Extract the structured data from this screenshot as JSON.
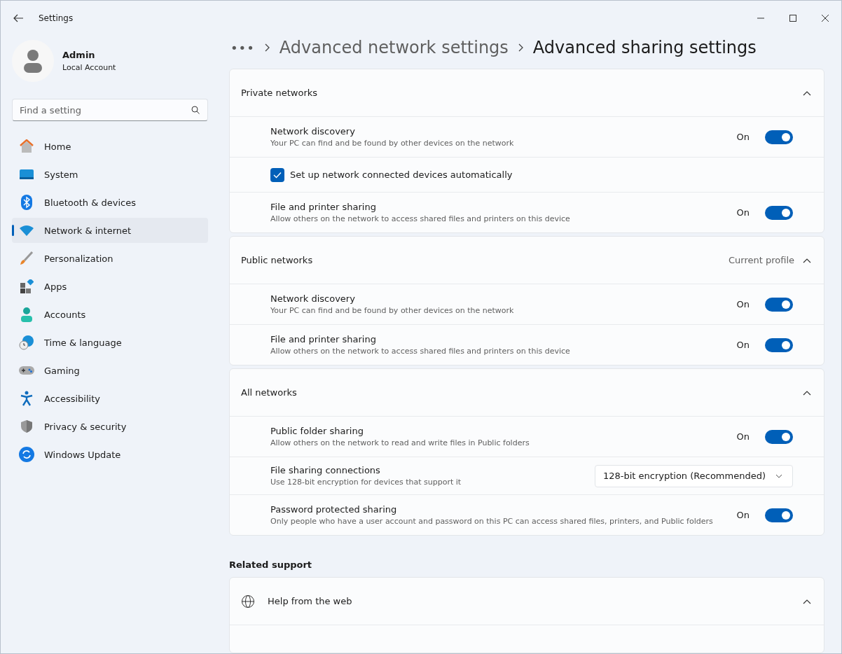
{
  "window": {
    "title": "Settings"
  },
  "user": {
    "name": "Admin",
    "account": "Local Account"
  },
  "search": {
    "placeholder": "Find a setting"
  },
  "sidebar": {
    "items": [
      {
        "label": "Home",
        "selected": false
      },
      {
        "label": "System",
        "selected": false
      },
      {
        "label": "Bluetooth & devices",
        "selected": false
      },
      {
        "label": "Network & internet",
        "selected": true
      },
      {
        "label": "Personalization",
        "selected": false
      },
      {
        "label": "Apps",
        "selected": false
      },
      {
        "label": "Accounts",
        "selected": false
      },
      {
        "label": "Time & language",
        "selected": false
      },
      {
        "label": "Gaming",
        "selected": false
      },
      {
        "label": "Accessibility",
        "selected": false
      },
      {
        "label": "Privacy & security",
        "selected": false
      },
      {
        "label": "Windows Update",
        "selected": false
      }
    ]
  },
  "breadcrumb": {
    "more": "•••",
    "items": [
      "Advanced network settings",
      "Advanced sharing settings"
    ]
  },
  "sections": [
    {
      "title": "Private networks",
      "expanded": true,
      "rows": [
        {
          "kind": "toggle",
          "title": "Network discovery",
          "description": "Your PC can find and be found by other devices on the network",
          "state_label": "On",
          "on": true
        },
        {
          "kind": "checkbox",
          "title": "Set up network connected devices automatically",
          "checked": true
        },
        {
          "kind": "toggle",
          "title": "File and printer sharing",
          "description": "Allow others on the network to access shared files and printers on this device",
          "state_label": "On",
          "on": true
        }
      ]
    },
    {
      "title": "Public networks",
      "note": "Current profile",
      "expanded": true,
      "rows": [
        {
          "kind": "toggle",
          "title": "Network discovery",
          "description": "Your PC can find and be found by other devices on the network",
          "state_label": "On",
          "on": true
        },
        {
          "kind": "toggle",
          "title": "File and printer sharing",
          "description": "Allow others on the network to access shared files and printers on this device",
          "state_label": "On",
          "on": true
        }
      ]
    },
    {
      "title": "All networks",
      "expanded": true,
      "rows": [
        {
          "kind": "toggle",
          "title": "Public folder sharing",
          "description": "Allow others on the network to read and write files in Public folders",
          "state_label": "On",
          "on": true
        },
        {
          "kind": "dropdown",
          "title": "File sharing connections",
          "description": "Use 128-bit encryption for devices that support it",
          "value": "128-bit encryption (Recommended)"
        },
        {
          "kind": "toggle",
          "title": "Password protected sharing",
          "description": "Only people who have a user account and password on this PC can access shared files, printers, and Public folders",
          "state_label": "On",
          "on": true
        }
      ]
    }
  ],
  "related": {
    "title": "Related support",
    "items": [
      {
        "label": "Help from the web",
        "expanded": true
      }
    ]
  }
}
